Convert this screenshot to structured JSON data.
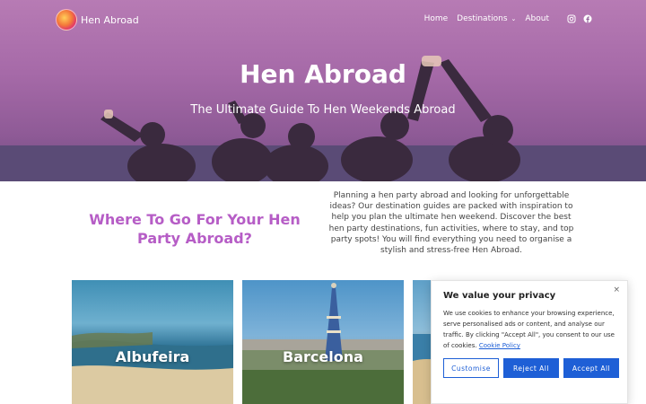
{
  "site": {
    "logo_text": "Hen Abroad"
  },
  "nav": {
    "items": [
      {
        "label": "Home"
      },
      {
        "label": "Destinations"
      },
      {
        "label": "About"
      }
    ],
    "social": [
      "instagram-icon",
      "facebook-icon"
    ]
  },
  "hero": {
    "title": "Hen Abroad",
    "subtitle": "The Ultimate Guide To Hen Weekends Abroad"
  },
  "intro": {
    "heading": "Where To Go For Your Hen Party Abroad?",
    "text": "Planning a hen party abroad and looking for unforgettable ideas? Our destination guides are packed with inspiration to help you plan the ultimate hen weekend. Discover the best hen party destinations, fun activities, where to stay, and top party spots! You will find everything you need to organise a stylish and stress-free Hen Abroad."
  },
  "destinations": [
    {
      "label": "Albufeira"
    },
    {
      "label": "Barcelona"
    },
    {
      "label": ""
    }
  ],
  "cookie": {
    "title": "We value your privacy",
    "body": "We use cookies to enhance your browsing experience, serve personalised ads or content, and analyse our traffic. By clicking \"Accept All\", you consent to our use of cookies.",
    "link": "Cookie Policy",
    "customise": "Customise",
    "reject": "Reject All",
    "accept": "Accept All",
    "close": "×"
  },
  "colors": {
    "accent": "#b65dc6",
    "button": "#1e5fd6"
  }
}
